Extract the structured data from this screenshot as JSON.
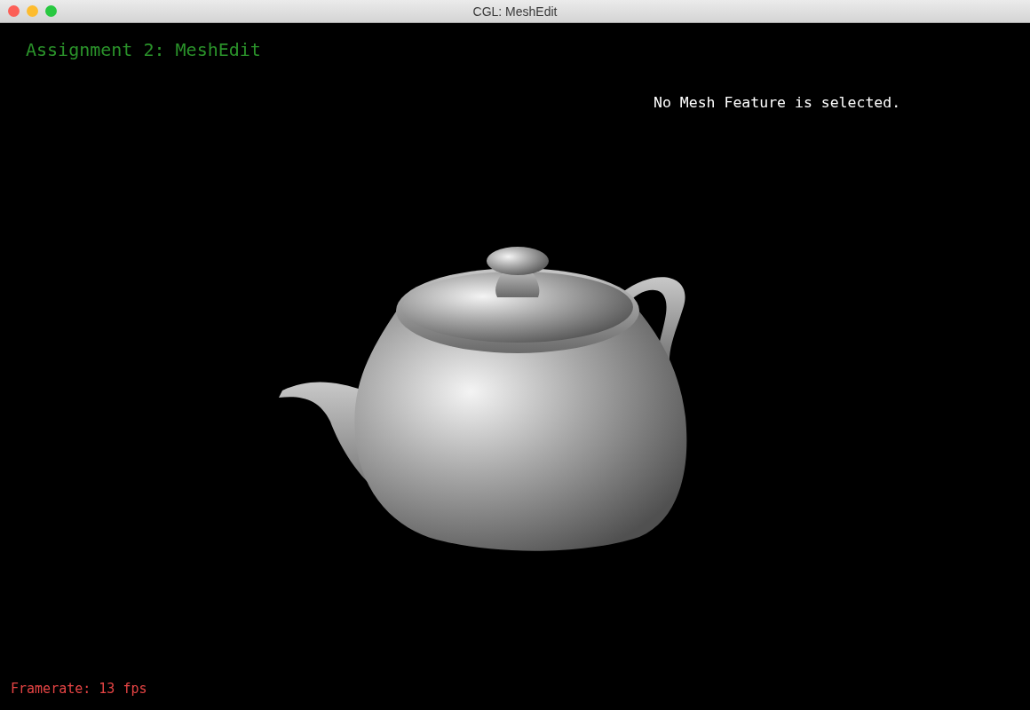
{
  "window": {
    "title": "CGL: MeshEdit"
  },
  "viewport": {
    "heading": "Assignment 2: MeshEdit",
    "selection_status": "No Mesh Feature is selected.",
    "framerate": "Framerate: 13 fps"
  }
}
